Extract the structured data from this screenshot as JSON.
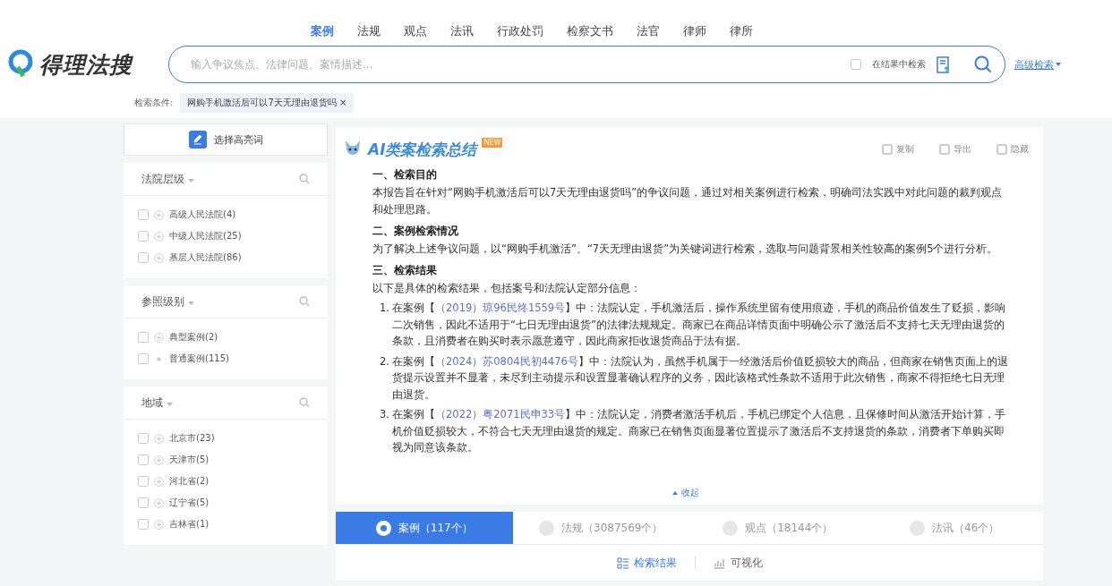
{
  "nav": [
    {
      "label": "案例",
      "selected": true
    },
    {
      "label": "法规",
      "selected": false
    },
    {
      "label": "观点",
      "selected": false
    },
    {
      "label": "法讯",
      "selected": false
    },
    {
      "label": "行政处罚",
      "selected": false
    },
    {
      "label": "检察文书",
      "selected": false
    },
    {
      "label": "法官",
      "selected": false
    },
    {
      "label": "律师",
      "selected": false
    },
    {
      "label": "律所",
      "selected": false
    }
  ],
  "logo": {
    "text": "得理法搜"
  },
  "search": {
    "placeholder": "输入争议焦点、法律问题、案情描述...",
    "in_results": {
      "label": "在结果中检索",
      "checked": false
    },
    "advanced": "高级检索"
  },
  "conditions": {
    "label": "检索条件:",
    "tags": [
      "网购手机激活后可以7天无理由退货吗"
    ],
    "remove": "×"
  },
  "highlight_button": "选择高亮词",
  "filters": [
    {
      "title": "法院层级",
      "options": [
        {
          "label": "高级人民法院(4)",
          "checked": false,
          "expandable": true
        },
        {
          "label": "中级人民法院(25)",
          "checked": false,
          "expandable": true
        },
        {
          "label": "基层人民法院(86)",
          "checked": false,
          "expandable": true
        }
      ]
    },
    {
      "title": "参照级别",
      "options": [
        {
          "label": "典型案例(2)",
          "checked": false,
          "expandable": true
        },
        {
          "label": "普通案例(115)",
          "checked": false,
          "expandable": false
        }
      ]
    },
    {
      "title": "地域",
      "options": [
        {
          "label": "北京市(23)",
          "checked": false,
          "expandable": true
        },
        {
          "label": "天津市(5)",
          "checked": false,
          "expandable": true
        },
        {
          "label": "河北省(2)",
          "checked": false,
          "expandable": true
        },
        {
          "label": "辽宁省(5)",
          "checked": false,
          "expandable": true
        },
        {
          "label": "吉林省(1)",
          "checked": false,
          "expandable": true
        }
      ]
    }
  ],
  "summary": {
    "title": "AI类案检索总结",
    "badge": "NEW",
    "actions": [
      "复制",
      "导出",
      "隐藏"
    ],
    "blocks": [
      {
        "kind": "heading",
        "text": "一、检索目的"
      },
      {
        "kind": "para",
        "text": "本报告旨在针对“网购手机激活后可以7天无理由退货吗”的争议问题，通过对相关案例进行检索，明确司法实践中对此问题的裁判观点和处理思路。"
      },
      {
        "kind": "heading",
        "text": "二、案例检索情况"
      },
      {
        "kind": "para",
        "text": "为了解决上述争议问题，以“网购手机激活”、“7天无理由退货”为关键词进行检索，选取与问题背景相关性较高的案例5个进行分析。"
      },
      {
        "kind": "heading",
        "text": "三、检索结果"
      },
      {
        "kind": "para",
        "text": "以下是具体的检索结果，包括案号和法院认定部分信息："
      }
    ],
    "cases": [
      {
        "number": "1.",
        "prefix": "在案例【",
        "link": "（2019）琼96民终1559号",
        "suffix": "】中：法院认定，手机激活后，操作系统里留有使用痕迹，手机的商品价值发生了贬损，影响二次销售，因此不适用于“七日无理由退货”的法律法规规定。商家已在商品详情页面中明确公示了激活后不支持七天无理由退货的条款，且消费者在购买时表示愿意遵守，因此商家拒收退货商品于法有据。"
      },
      {
        "number": "2.",
        "prefix": "在案例【",
        "link": "（2024）苏0804民初4476号",
        "suffix": "】中：法院认为，虽然手机属于一经激活后价值贬损较大的商品，但商家在销售页面上的退货提示设置并不显著，未尽到主动提示和设置显著确认程序的义务，因此该格式性条款不适用于此次销售，商家不得拒绝七日无理由退货。"
      },
      {
        "number": "3.",
        "prefix": "在案例【",
        "link": "（2022）粤2071民申33号",
        "suffix": "】中：法院认定，消费者激活手机后，手机已绑定个人信息，且保修时间从激活开始计算，手机价值贬损较大，不符合七天无理由退货的规定。商家已在销售页面显著位置提示了激活后不支持退货的条款，消费者下单购买即视为同意该条款。"
      }
    ],
    "collapse": "收起"
  },
  "result_tabs": [
    {
      "label": "案例（117个）",
      "selected": true
    },
    {
      "label": "法规（3087569个）",
      "selected": false
    },
    {
      "label": "观点（18144个）",
      "selected": false
    },
    {
      "label": "法讯（46个）",
      "selected": false
    }
  ],
  "views": [
    {
      "label": "检索结果",
      "selected": true
    },
    {
      "label": "可视化",
      "selected": false
    }
  ]
}
